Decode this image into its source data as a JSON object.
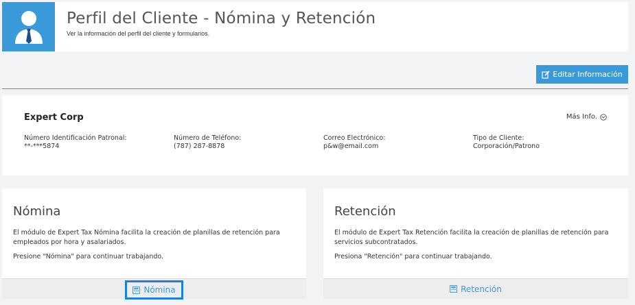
{
  "header": {
    "title": "Perfil del Cliente - Nómina y Retención",
    "subtitle": "Ver la información del perfil del cliente y formularios.",
    "icon": "user-tie-icon"
  },
  "actions": {
    "edit_label": "Editar Información"
  },
  "client": {
    "name": "Expert Corp",
    "more_info_label": "Más Info.",
    "fields": [
      {
        "label": "Número Identificación Patronal:",
        "value": "**-***5874"
      },
      {
        "label": "Número de Teléfono:",
        "value": "(787) 287-8878"
      },
      {
        "label": "Correo Electrónico:",
        "value": "p&w@email.com"
      },
      {
        "label": "Tipo de Cliente:",
        "value": "Corporación/Patrono"
      }
    ]
  },
  "modules": [
    {
      "title": "Nómina",
      "description": "El módulo de Expert Tax Nómina facilita la creación de planillas de retención para empleados por hora y asalariados.",
      "hint": "Presione \"Nómina\" para continuar trabajando.",
      "button_label": "Nómina"
    },
    {
      "title": "Retención",
      "description": "El módulo de Expert Tax Retención facilita la creación de planillas de retención para servicios subcontratados.",
      "hint": "Presiona \"Retención\" para continuar trabajando.",
      "button_label": "Retención"
    }
  ],
  "colors": {
    "accent": "#3a9ad9",
    "highlight_border": "#1a7fe0",
    "background": "#f1f3f5"
  }
}
